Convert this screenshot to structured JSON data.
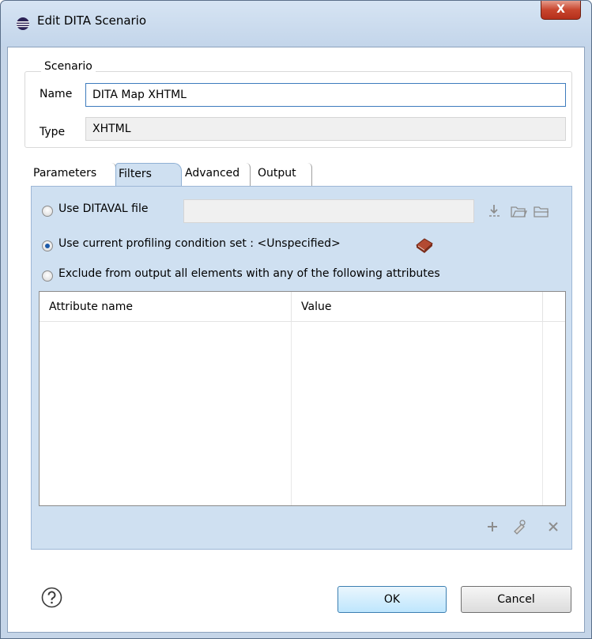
{
  "window": {
    "title": "Edit DITA Scenario",
    "close_label": "X"
  },
  "scenario": {
    "group_label": "Scenario",
    "name_label": "Name",
    "name_value": "DITA Map XHTML",
    "type_label": "Type",
    "type_value": "XHTML"
  },
  "tabs": [
    {
      "label": "Parameters",
      "active": false
    },
    {
      "label": "Filters",
      "active": true
    },
    {
      "label": "Advanced",
      "active": false
    },
    {
      "label": "Output",
      "active": false
    }
  ],
  "filters": {
    "ditaval_label": "Use DITAVAL file",
    "ditaval_value": "",
    "profiling_label": "Use current profiling condition set : <Unspecified>",
    "exclude_label": "Exclude from output all elements with any of the following attributes",
    "selected_option": "profiling",
    "table": {
      "columns": [
        "Attribute name",
        "Value"
      ],
      "rows": []
    }
  },
  "buttons": {
    "ok": "OK",
    "cancel": "Cancel"
  },
  "icons": {
    "title": "eclipse-icon",
    "ditaval_actions": [
      "insert-editor-variables-icon",
      "browse-workspace-icon",
      "browse-local-icon"
    ],
    "profiling": "book-icon",
    "table_actions": [
      "add-icon",
      "edit-icon",
      "remove-icon"
    ],
    "help": "help-icon"
  },
  "colors": {
    "accent": "#3d7bbd",
    "close_button": "#c8452d",
    "tab_panel": "#cfe0f1"
  }
}
